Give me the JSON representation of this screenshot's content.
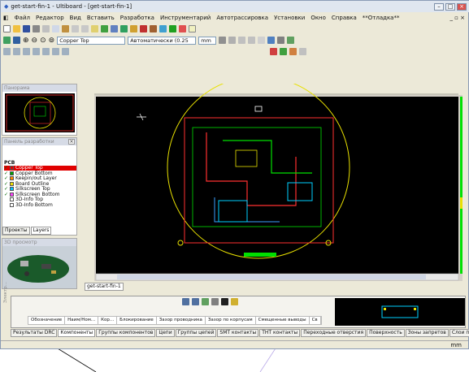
{
  "window": {
    "title": "get-start-fin-1 - Ultiboard - [get-start-fin-1]"
  },
  "menu": [
    "Файл",
    "Редактор",
    "Вид",
    "Вставить",
    "Разработка",
    "Инструментарий",
    "Автотрассировка",
    "Установки",
    "Окно",
    "Справка",
    "**Отладка**"
  ],
  "toolbar": {
    "layer_select": "Copper Top",
    "mode_select": "Автоматически (0.25",
    "unit_select": "mm"
  },
  "panels": {
    "overview": "Панорама",
    "design": "Панель разработки",
    "view3d": "3D просмотр"
  },
  "layers": {
    "header": "PCB",
    "items": [
      {
        "label": "Copper Top",
        "color": "#e00000"
      },
      {
        "label": "Copper Bottom",
        "color": "#00a000"
      },
      {
        "label": "Keepin/out Layer",
        "color": "#ff8800"
      },
      {
        "label": "Board Outline",
        "color": "#f0e000"
      },
      {
        "label": "Silkscreen Top",
        "color": "#00c0ff"
      },
      {
        "label": "Silkscreen Bottom",
        "color": "#ff40ff"
      },
      {
        "label": "3D-Info Top",
        "color": "#ffffff"
      },
      {
        "label": "3D-Info Bottom",
        "color": "#ffffff"
      }
    ]
  },
  "side_tabs": [
    "Проекты",
    "Layers"
  ],
  "doc_tab": "get-start-fin-1",
  "table_columns": [
    "Обозначение",
    "Наим/Ном...",
    "Кор...",
    "Блокирование",
    "Зазор проводника",
    "Зазор по корпусам",
    "Смещенные выводы",
    "Св"
  ],
  "spreadsheet_label": "Электр...",
  "bottom_tabs": [
    "Результаты DRC",
    "Компоненты",
    "Группы компонентов",
    "Цепи",
    "Группы цепей",
    "SMT контакты",
    "THT контакты",
    "Переходные отверстия",
    "Поверхность",
    "Зоны запретов",
    "Слои плат"
  ],
  "status": {
    "unit": "mm"
  },
  "colors": {
    "canvas": "#000000",
    "board_outline": "#e8e000",
    "trace_red": "#ff3030",
    "trace_green": "#00e000",
    "silk": "#00d0ff"
  }
}
